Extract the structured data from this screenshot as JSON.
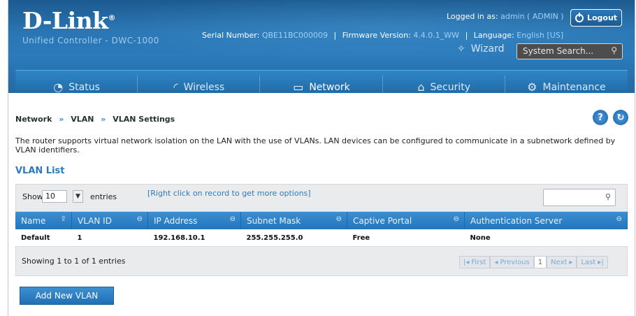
{
  "header": {
    "logo": "D-Link",
    "logo_trademark": "®",
    "product": "Unified Controller - DWC-1000",
    "logged_in_label": "Logged in as:",
    "logged_in_value": "admin ( ADMIN )",
    "serial_label": "Serial Number:",
    "serial_value": "QBE11BC000009",
    "firmware_label": "Firmware Version:",
    "firmware_value": "4.4.0.1_WW",
    "language_label": "Language:",
    "language_value": "English [US]",
    "logout_label": "Logout",
    "wizard_label": "Wizard",
    "search_placeholder": "System Search..."
  },
  "nav": {
    "items": [
      {
        "label": "Status",
        "icon": "gauge-icon"
      },
      {
        "label": "Wireless",
        "icon": "wifi-icon"
      },
      {
        "label": "Network",
        "icon": "monitor-icon"
      },
      {
        "label": "Security",
        "icon": "lock-icon"
      },
      {
        "label": "Maintenance",
        "icon": "gears-icon"
      }
    ],
    "active": "Network"
  },
  "breadcrumb": {
    "level1": "Network",
    "level2": "VLAN",
    "level3": "VLAN Settings",
    "sep": "»"
  },
  "description": "The router supports virtual network isolation on the LAN with the use of VLANs. LAN devices can be configured to communicate in a subnetwork defined by VLAN identifiers.",
  "vlan_list": {
    "title": "VLAN List",
    "show_label": "Show",
    "page_length": "10",
    "entries_label": "entries",
    "hint": "[Right click on record to get more options]",
    "columns": [
      "Name",
      "VLAN ID",
      "IP Address",
      "Subnet Mask",
      "Captive Portal",
      "Authentication Server"
    ],
    "rows": [
      [
        "Default",
        "1",
        "192.168.10.1",
        "255.255.255.0",
        "Free",
        "None"
      ]
    ],
    "info": "Showing 1 to 1 of 1 entries",
    "pager": {
      "first": "First",
      "previous": "Previous",
      "current": "1",
      "next": "Next",
      "last": "Last"
    }
  },
  "add_button": "Add New VLAN"
}
